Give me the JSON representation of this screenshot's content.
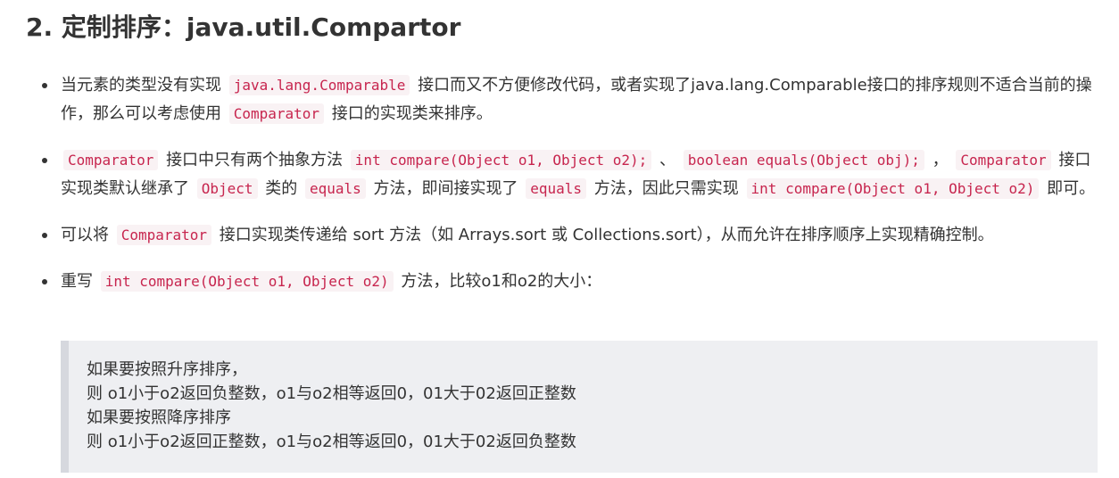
{
  "heading": "2. 定制排序：java.util.Compartor",
  "bullets": [
    {
      "segments": [
        {
          "type": "text",
          "text": "当元素的类型没有实现"
        },
        {
          "type": "code",
          "text": "java.lang.Comparable"
        },
        {
          "type": "text",
          "text": "接口而又不方便修改代码，或者实现了java.lang.Comparable接口的排序规则不适合当前的操作，那么可以考虑使用"
        },
        {
          "type": "code",
          "text": "Comparator"
        },
        {
          "type": "text",
          "text": "接口的实现类来排序。"
        }
      ]
    },
    {
      "segments": [
        {
          "type": "code",
          "text": "Comparator"
        },
        {
          "type": "text",
          "text": "接口中只有两个抽象方法"
        },
        {
          "type": "code",
          "text": "int compare(Object o1, Object o2);"
        },
        {
          "type": "text",
          "text": "、"
        },
        {
          "type": "code",
          "text": "boolean equals(Object obj);"
        },
        {
          "type": "text",
          "text": "，"
        },
        {
          "type": "code",
          "text": "Comparator"
        },
        {
          "type": "text",
          "text": "接口实现类默认继承了"
        },
        {
          "type": "code",
          "text": "Object"
        },
        {
          "type": "text",
          "text": "类的"
        },
        {
          "type": "code",
          "text": "equals"
        },
        {
          "type": "text",
          "text": "方法，即间接实现了"
        },
        {
          "type": "code",
          "text": "equals"
        },
        {
          "type": "text",
          "text": "方法，因此只需实现"
        },
        {
          "type": "code",
          "text": "int compare(Object o1, Object o2)"
        },
        {
          "type": "text",
          "text": "即可。"
        }
      ]
    },
    {
      "segments": [
        {
          "type": "text",
          "text": "可以将"
        },
        {
          "type": "code",
          "text": "Comparator"
        },
        {
          "type": "text",
          "text": "接口实现类传递给 sort 方法（如 Arrays.sort 或 Collections.sort），从而允许在排序顺序上实现精确控制。"
        }
      ]
    },
    {
      "segments": [
        {
          "type": "text",
          "text": "重写"
        },
        {
          "type": "code",
          "text": "int compare(Object o1, Object o2)"
        },
        {
          "type": "text",
          "text": "方法，比较o1和o2的大小："
        }
      ]
    }
  ],
  "quote_lines": [
    "如果要按照升序排序，",
    "则 o1小于o2返回负整数，o1与o2相等返回0，01大于02返回正整数",
    "如果要按照降序排序",
    "则 o1小于o2返回正整数，o1与o2相等返回0，01大于02返回负整数"
  ]
}
